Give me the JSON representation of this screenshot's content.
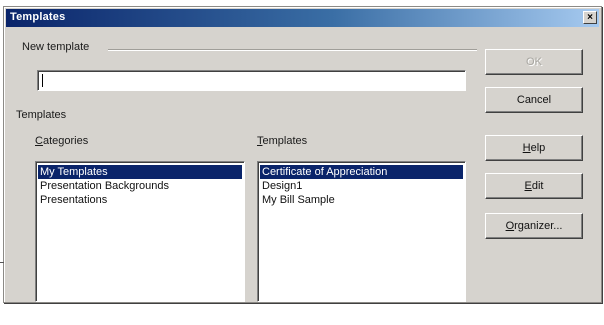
{
  "window": {
    "title": "Templates",
    "close_glyph": "×"
  },
  "new_template": {
    "group_label": "New template",
    "value": ""
  },
  "templates_section": {
    "group_label": "Templates",
    "categories": {
      "label_prefix": "",
      "label_accel": "C",
      "label_rest": "ategories",
      "items": [
        "My Templates",
        "Presentation Backgrounds",
        "Presentations"
      ],
      "selected_index": 0
    },
    "templates": {
      "label_accel": "T",
      "label_rest": "emplates",
      "items": [
        "Certificate of Appreciation",
        "Design1",
        "My Bill Sample"
      ],
      "selected_index": 0
    }
  },
  "buttons": {
    "ok": "OK",
    "cancel": "Cancel",
    "help_accel": "H",
    "help_rest": "elp",
    "edit_accel": "E",
    "edit_rest": "dit",
    "organizer_accel": "O",
    "organizer_rest": "rganizer..."
  },
  "colors": {
    "titlebar_start": "#0a246a",
    "titlebar_end": "#a6caf0",
    "selection": "#0a246a",
    "face": "#d6d3ce"
  }
}
